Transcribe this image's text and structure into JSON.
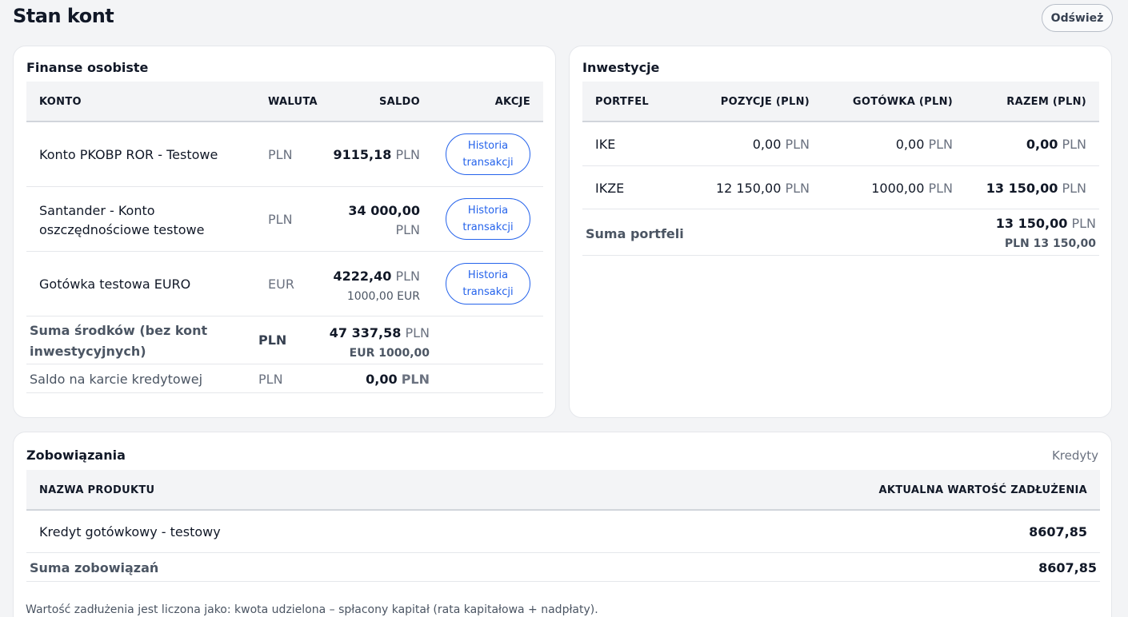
{
  "header": {
    "title": "Stan kont",
    "refresh_label": "Odśwież"
  },
  "personal": {
    "title": "Finanse osobiste",
    "columns": [
      "KONTO",
      "WALUTA",
      "SALDO",
      "AKCJE"
    ],
    "rows": [
      {
        "name": "Konto PKOBP ROR - Testowe",
        "currency": "PLN",
        "balance": "9115,18",
        "balance_ccy": "PLN",
        "action_line1": "Historia",
        "action_line2": "transakcji"
      },
      {
        "name_line1": "Santander - Konto",
        "name_line2": "oszczędnościowe testowe",
        "currency": "PLN",
        "balance": "34 000,00",
        "balance_ccy": "PLN",
        "action_line1": "Historia",
        "action_line2": "transakcji"
      },
      {
        "name": "Gotówka testowa EURO",
        "currency": "EUR",
        "balance": "4222,40",
        "balance_ccy": "PLN",
        "balance_sub": "1000,00 EUR",
        "action_line1": "Historia",
        "action_line2": "transakcji"
      }
    ],
    "sum": {
      "label_line1": "Suma środków (bez kont",
      "label_line2": "inwestycyjnych)",
      "currency": "PLN",
      "value": "47 337,58",
      "value_ccy": "PLN",
      "value_sub": "EUR 1000,00"
    },
    "credit_card": {
      "label": "Saldo na karcie kredytowej",
      "currency": "PLN",
      "value": "0,00",
      "value_ccy": "PLN"
    }
  },
  "investments": {
    "title": "Inwestycje",
    "columns": [
      "PORTFEL",
      "POZYCJE (PLN)",
      "GOTÓWKA (PLN)",
      "RAZEM (PLN)"
    ],
    "rows": [
      {
        "name": "IKE",
        "positions": "0,00",
        "cash": "0,00",
        "total": "0,00",
        "ccy": "PLN"
      },
      {
        "name": "IKZE",
        "positions": "12 150,00",
        "cash": "1000,00",
        "total": "13 150,00",
        "ccy": "PLN"
      }
    ],
    "sum": {
      "label": "Suma portfeli",
      "value": "13 150,00",
      "value_ccy": "PLN",
      "value_sub": "PLN 13 150,00"
    }
  },
  "liabilities": {
    "title": "Zobowiązania",
    "link": "Kredyty",
    "columns": [
      "NAZWA PRODUKTU",
      "AKTUALNA WARTOŚĆ ZADŁUŻENIA"
    ],
    "rows": [
      {
        "name": "Kredyt gotówkowy - testowy",
        "value": "8607,85"
      }
    ],
    "sum": {
      "label": "Suma zobowiązań",
      "value": "8607,85"
    },
    "footnote": "Wartość zadłużenia jest liczona jako: kwota udzielona – spłacony kapitał (rata kapitałowa + nadpłaty)."
  }
}
